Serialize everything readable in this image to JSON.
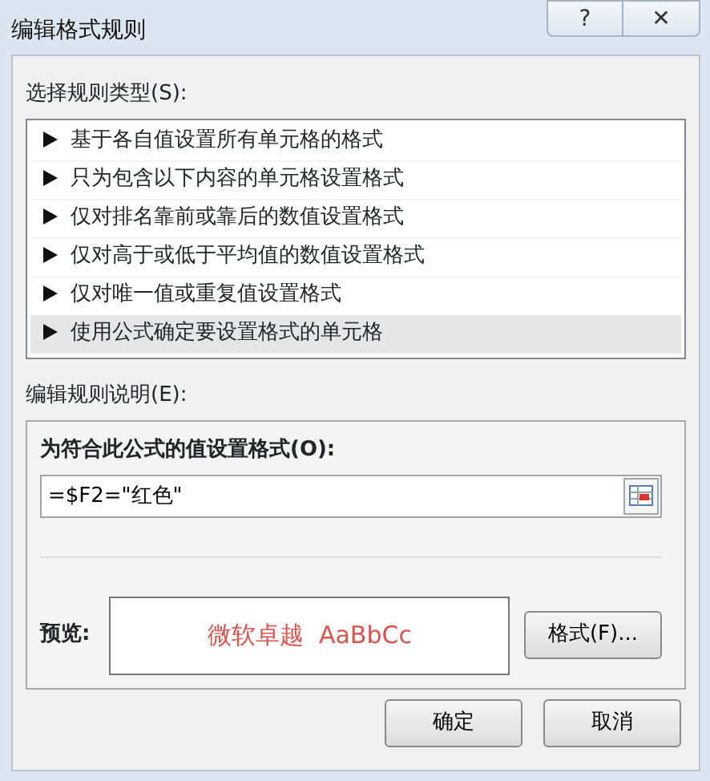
{
  "window": {
    "title": "编辑格式规则",
    "help_button": "?",
    "close_button": "✕"
  },
  "rule_type": {
    "label": "选择规则类型(S):",
    "items": [
      {
        "text": "基于各自值设置所有单元格的格式",
        "selected": false
      },
      {
        "text": "只为包含以下内容的单元格设置格式",
        "selected": false
      },
      {
        "text": "仅对排名靠前或靠后的数值设置格式",
        "selected": false
      },
      {
        "text": "仅对高于或低于平均值的数值设置格式",
        "selected": false
      },
      {
        "text": "仅对唯一值或重复值设置格式",
        "selected": false
      },
      {
        "text": "使用公式确定要设置格式的单元格",
        "selected": true
      }
    ]
  },
  "description": {
    "label": "编辑规则说明(E):",
    "formula_label": "为符合此公式的值设置格式(O):",
    "formula": "=$F2=\"红色\"",
    "preview_label": "预览:",
    "preview_text": "微软卓越  AaBbCc",
    "format_button": "格式(F)..."
  },
  "buttons": [
    "确定",
    "取消"
  ]
}
